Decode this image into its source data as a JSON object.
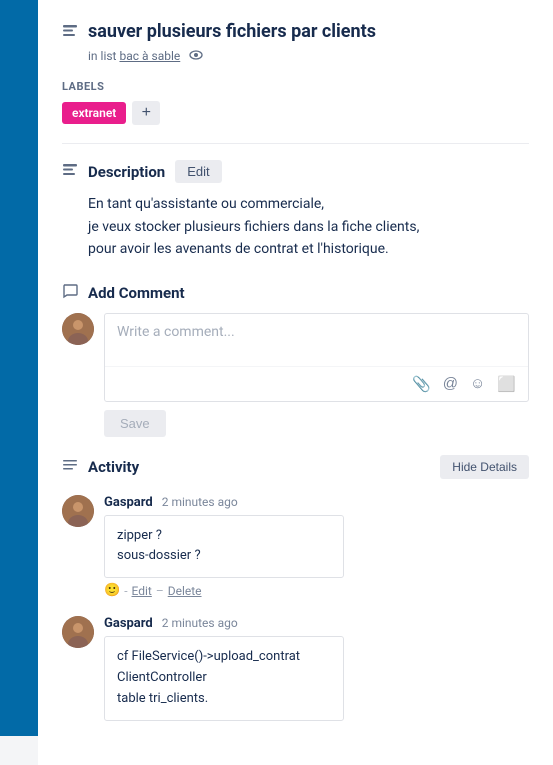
{
  "sidebar": {
    "color": "#026aa7"
  },
  "card": {
    "title": "sauver plusieurs fichiers par clients",
    "in_list_prefix": "in list",
    "list_name": "bac à sable",
    "labels_title": "LABELS",
    "label_badge": "extranet",
    "label_add_btn": "+",
    "description": {
      "section_title": "Description",
      "edit_btn": "Edit",
      "text_line1": "En tant qu'assistante ou commerciale,",
      "text_line2": "je veux stocker plusieurs fichiers dans la fiche clients,",
      "text_line3": "pour avoir les avenants de contrat et l'historique."
    },
    "add_comment": {
      "title": "Add Comment",
      "placeholder": "Write a comment...",
      "save_btn": "Save"
    },
    "activity": {
      "title": "Activity",
      "hide_details_btn": "Hide Details",
      "items": [
        {
          "author": "Gaspard",
          "time": "2 minutes ago",
          "comment_line1": "zipper ?",
          "comment_line2": "sous-dossier ?",
          "edit_link": "Edit",
          "delete_link": "Delete"
        },
        {
          "author": "Gaspard",
          "time": "2 minutes ago",
          "comment_line1": "cf FileService()->upload_contrat",
          "comment_line2": "ClientController",
          "comment_line3": "table tri_clients."
        }
      ]
    }
  }
}
